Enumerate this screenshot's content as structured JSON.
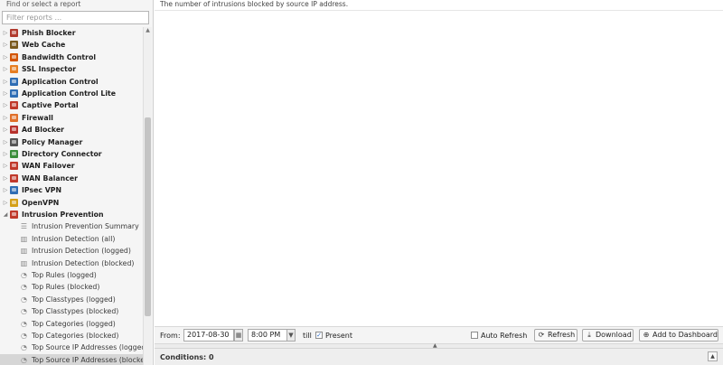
{
  "sidebar": {
    "title": "Find or select a report",
    "filter_placeholder": "Filter reports ...",
    "apps": [
      {
        "label": "Phish Blocker",
        "color": "#b03a2e"
      },
      {
        "label": "Web Cache",
        "color": "#7a5a1e"
      },
      {
        "label": "Bandwidth Control",
        "color": "#d35400"
      },
      {
        "label": "SSL Inspector",
        "color": "#e67e22"
      },
      {
        "label": "Application Control",
        "color": "#2e6db4"
      },
      {
        "label": "Application Control Lite",
        "color": "#2e6db4"
      },
      {
        "label": "Captive Portal",
        "color": "#c0392b"
      },
      {
        "label": "Firewall",
        "color": "#e0702a"
      },
      {
        "label": "Ad Blocker",
        "color": "#b7322c"
      },
      {
        "label": "Policy Manager",
        "color": "#555555"
      },
      {
        "label": "Directory Connector",
        "color": "#3a8d3a"
      },
      {
        "label": "WAN Failover",
        "color": "#c0392b"
      },
      {
        "label": "WAN Balancer",
        "color": "#c0392b"
      },
      {
        "label": "IPsec VPN",
        "color": "#2e6db4"
      },
      {
        "label": "OpenVPN",
        "color": "#d4a017"
      },
      {
        "label": "Intrusion Prevention",
        "color": "#c0392b",
        "expanded": true
      }
    ],
    "reports": [
      {
        "label": "Intrusion Prevention Summary",
        "icon": "text"
      },
      {
        "label": "Intrusion Detection (all)",
        "icon": "bar"
      },
      {
        "label": "Intrusion Detection (logged)",
        "icon": "bar"
      },
      {
        "label": "Intrusion Detection (blocked)",
        "icon": "bar"
      },
      {
        "label": "Top Rules (logged)",
        "icon": "pie"
      },
      {
        "label": "Top Rules (blocked)",
        "icon": "pie"
      },
      {
        "label": "Top Classtypes (logged)",
        "icon": "pie"
      },
      {
        "label": "Top Classtypes (blocked)",
        "icon": "pie"
      },
      {
        "label": "Top Categories (logged)",
        "icon": "pie"
      },
      {
        "label": "Top Categories (blocked)",
        "icon": "pie"
      },
      {
        "label": "Top Source IP Addresses (logged)",
        "icon": "pie"
      },
      {
        "label": "Top Source IP Addresses (blocked)",
        "icon": "pie",
        "selected": true
      }
    ]
  },
  "main": {
    "description": "The number of intrusions blocked by source IP address."
  },
  "toolbar": {
    "from_label": "From:",
    "date_value": "2017-08-30",
    "time_value": "8:00 PM",
    "till_label": "till",
    "present_label": "Present",
    "present_checked": true,
    "auto_refresh_label": "Auto Refresh",
    "auto_refresh_checked": false,
    "refresh_label": "Refresh",
    "download_label": "Download",
    "add_dashboard_label": "Add to Dashboard"
  },
  "conditions": {
    "label": "Conditions: 0"
  }
}
